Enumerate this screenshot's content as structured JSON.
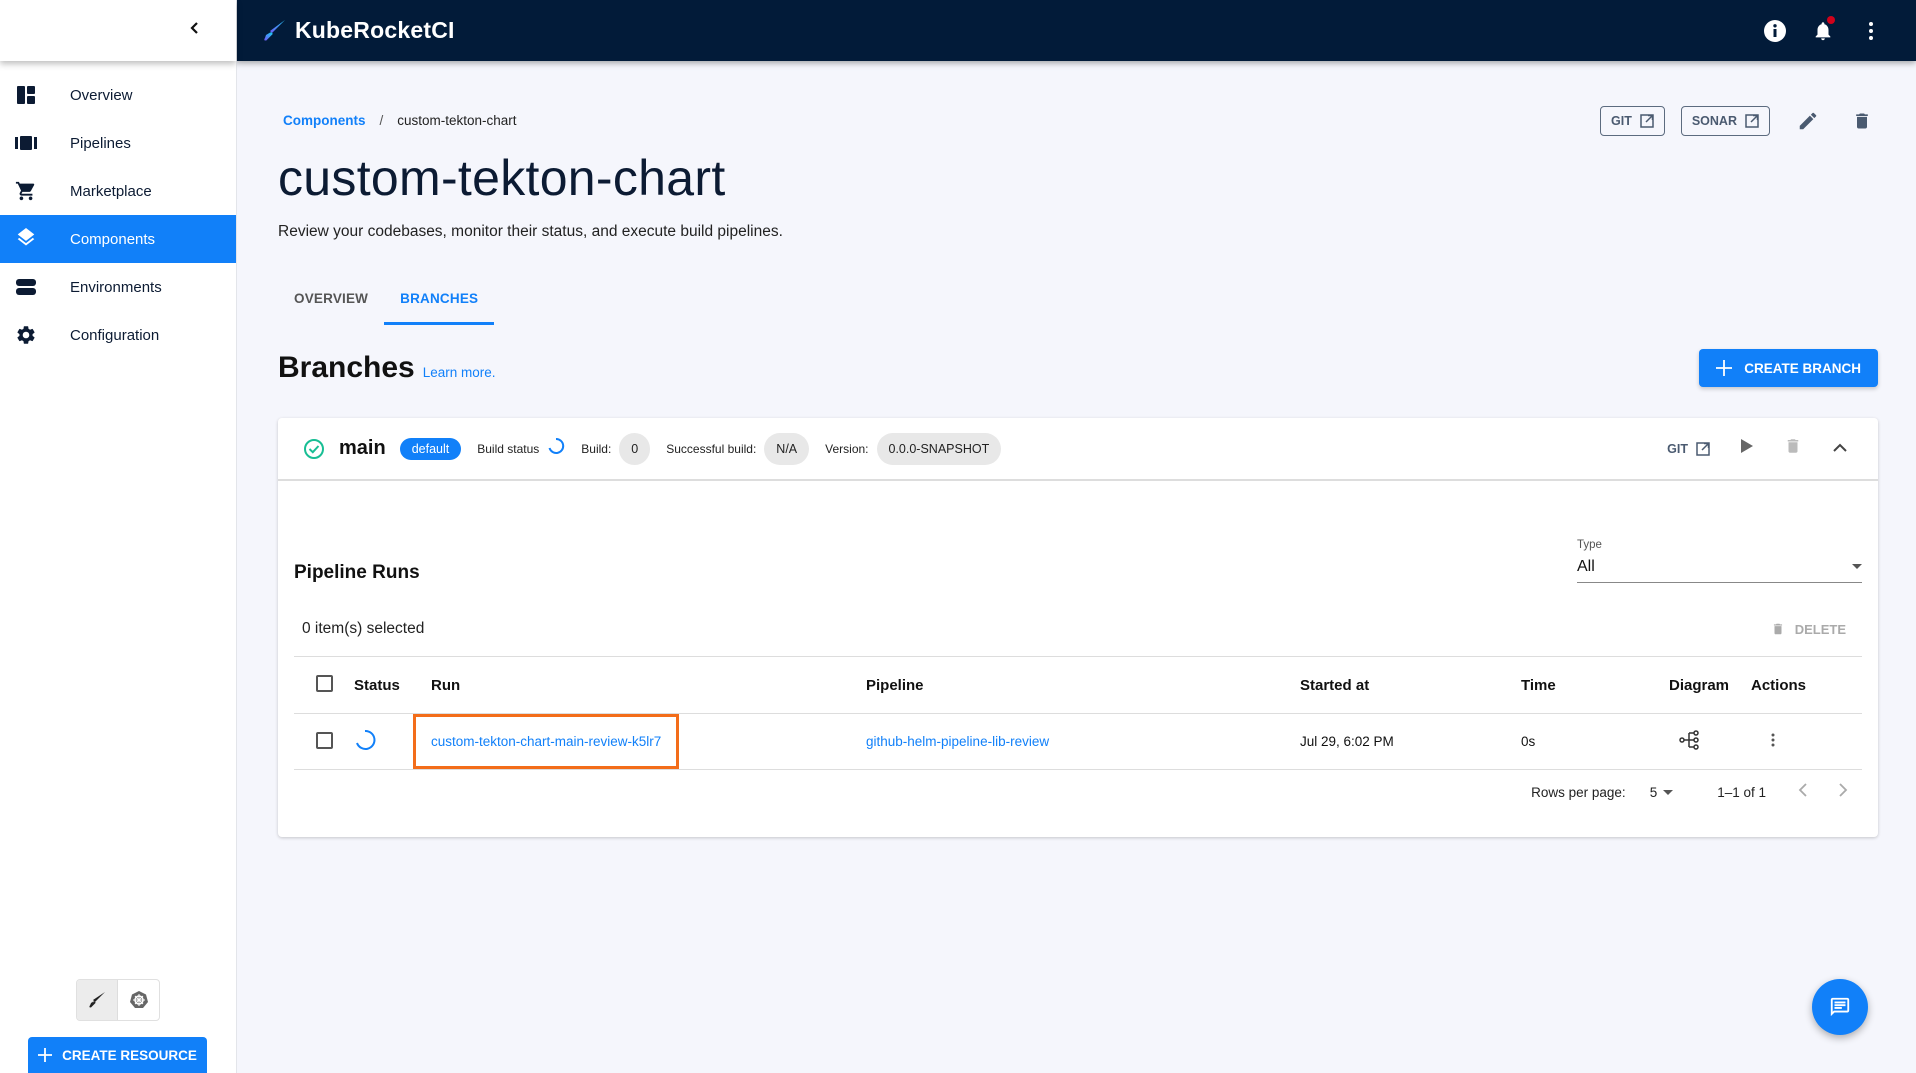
{
  "app": {
    "title": "KubeRocketCI"
  },
  "sidebar": {
    "items": [
      {
        "label": "Overview",
        "icon": "dashboard-icon"
      },
      {
        "label": "Pipelines",
        "icon": "pipelines-icon"
      },
      {
        "label": "Marketplace",
        "icon": "cart-icon"
      },
      {
        "label": "Components",
        "icon": "layers-icon",
        "active": true
      },
      {
        "label": "Environments",
        "icon": "environments-icon"
      },
      {
        "label": "Configuration",
        "icon": "gear-icon"
      }
    ],
    "create_resource": "CREATE RESOURCE"
  },
  "breadcrumb": {
    "parent": "Components",
    "sep": "/",
    "current": "custom-tekton-chart"
  },
  "header": {
    "git_label": "GIT",
    "sonar_label": "SONAR",
    "title": "custom-tekton-chart",
    "subtitle": "Review your codebases, monitor their status, and execute build pipelines."
  },
  "tabs": [
    {
      "label": "OVERVIEW"
    },
    {
      "label": "BRANCHES",
      "active": true
    }
  ],
  "branches": {
    "heading": "Branches",
    "learn_more": "Learn more.",
    "create_label": "CREATE BRANCH"
  },
  "branch": {
    "name": "main",
    "badge": "default",
    "build_status_label": "Build status",
    "build_label": "Build:",
    "build_value": "0",
    "successful_label": "Successful build:",
    "successful_value": "N/A",
    "version_label": "Version:",
    "version_value": "0.0.0-SNAPSHOT",
    "git_label": "GIT"
  },
  "pipeline_runs": {
    "title": "Pipeline Runs",
    "type_label": "Type",
    "type_value": "All",
    "selected_text": "0 item(s) selected",
    "delete_label": "DELETE",
    "columns": [
      "Status",
      "Run",
      "Pipeline",
      "Started at",
      "Time",
      "Diagram",
      "Actions"
    ],
    "rows": [
      {
        "run": "custom-tekton-chart-main-review-k5lr7",
        "pipeline": "github-helm-pipeline-lib-review",
        "started": "Jul 29, 6:02 PM",
        "time": "0s"
      }
    ],
    "rows_per_page_label": "Rows per page:",
    "rows_per_page": "5",
    "page_count": "1–1 of 1"
  },
  "colors": {
    "accent": "#1180f9",
    "topbar": "#021b39",
    "highlight": "#f36d1a"
  }
}
